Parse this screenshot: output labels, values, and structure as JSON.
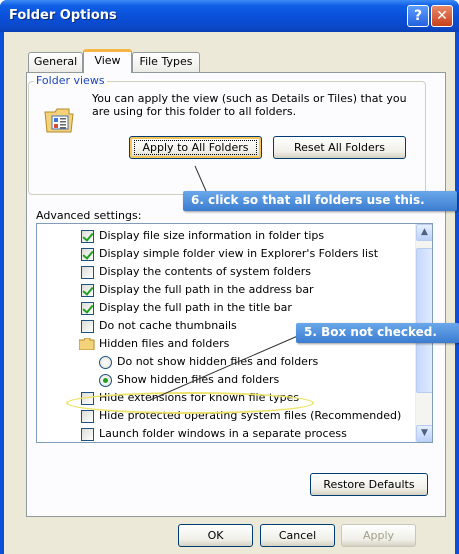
{
  "window": {
    "title": "Folder Options",
    "help_glyph": "?",
    "close_glyph": "✕"
  },
  "tabs": [
    {
      "label": "General"
    },
    {
      "label": "View",
      "selected": true
    },
    {
      "label": "File Types"
    }
  ],
  "folder_views": {
    "legend": "Folder views",
    "description": "You can apply the view (such as Details or Tiles) that you are using for this folder to all folders.",
    "apply_label": "Apply to All Folders",
    "reset_label": "Reset All Folders"
  },
  "advanced": {
    "label": "Advanced settings:",
    "items": [
      {
        "type": "checkbox",
        "checked": true,
        "label": "Display file size information in folder tips"
      },
      {
        "type": "checkbox",
        "checked": true,
        "label": "Display simple folder view in Explorer's Folders list"
      },
      {
        "type": "checkbox",
        "checked": false,
        "label": "Display the contents of system folders"
      },
      {
        "type": "checkbox",
        "checked": true,
        "label": "Display the full path in the address bar"
      },
      {
        "type": "checkbox",
        "checked": true,
        "label": "Display the full path in the title bar"
      },
      {
        "type": "checkbox",
        "checked": false,
        "label": "Do not cache thumbnails"
      },
      {
        "type": "folder",
        "label": "Hidden files and folders"
      },
      {
        "type": "radio",
        "checked": false,
        "label": "Do not show hidden files and folders"
      },
      {
        "type": "radio",
        "checked": true,
        "label": "Show hidden files and folders"
      },
      {
        "type": "checkbox",
        "checked": false,
        "label": "Hide extensions for known file types"
      },
      {
        "type": "checkbox",
        "checked": false,
        "label": "Hide protected operating system files (Recommended)"
      },
      {
        "type": "checkbox",
        "checked": false,
        "label": "Launch folder windows in a separate process"
      }
    ],
    "restore_label": "Restore Defaults"
  },
  "footer": {
    "ok_label": "OK",
    "cancel_label": "Cancel",
    "apply_label": "Apply"
  },
  "annotations": {
    "step6": "6. click so that all folders use this.",
    "step5": "5. Box not checked."
  },
  "colors": {
    "titlebar": "#0a4fd8",
    "client": "#ece9d8",
    "callout": "#4a8ad8",
    "highlight_ellipse": "#ede36a",
    "checkmark": "#21a121"
  }
}
